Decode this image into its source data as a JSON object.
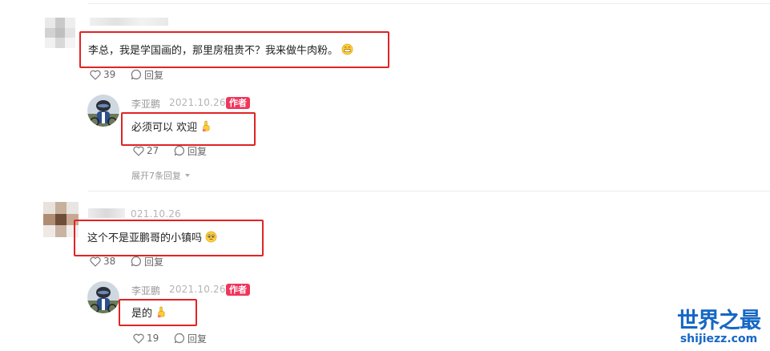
{
  "comments": [
    {
      "username": "",
      "date": "",
      "text": "李总，我是学国画的，那里房租贵不？我来做牛肉粉。",
      "likes": "39",
      "reply_label": "回复",
      "reply": {
        "username": "李亚鹏",
        "date": "2021.10.26",
        "badge": "作者",
        "text": "必须可以 欢迎",
        "likes": "27",
        "reply_label": "回复"
      },
      "expand_label": "展开7条回复"
    },
    {
      "username": "",
      "date": "021.10.26",
      "text": "这个不是亚鹏哥的小镇吗",
      "likes": "38",
      "reply_label": "回复",
      "reply": {
        "username": "李亚鹏",
        "date": "2021.10.26",
        "badge": "作者",
        "text": "是的",
        "likes": "19",
        "reply_label": "回复"
      }
    }
  ],
  "watermark": {
    "title": "世界之最",
    "url": "shijiezz.com"
  },
  "colors": {
    "highlight_box": "#e02424",
    "author_badge": "#f0365c",
    "watermark": "#1667c4"
  },
  "icons": {
    "like": "heart-outline-icon",
    "reply": "speech-bubble-icon",
    "expand": "caret-down-icon",
    "emoji_grin": "grinning-emoji-icon",
    "emoji_hand": "pointing-hand-emoji-icon",
    "emoji_pleading": "pleading-face-emoji-icon"
  }
}
